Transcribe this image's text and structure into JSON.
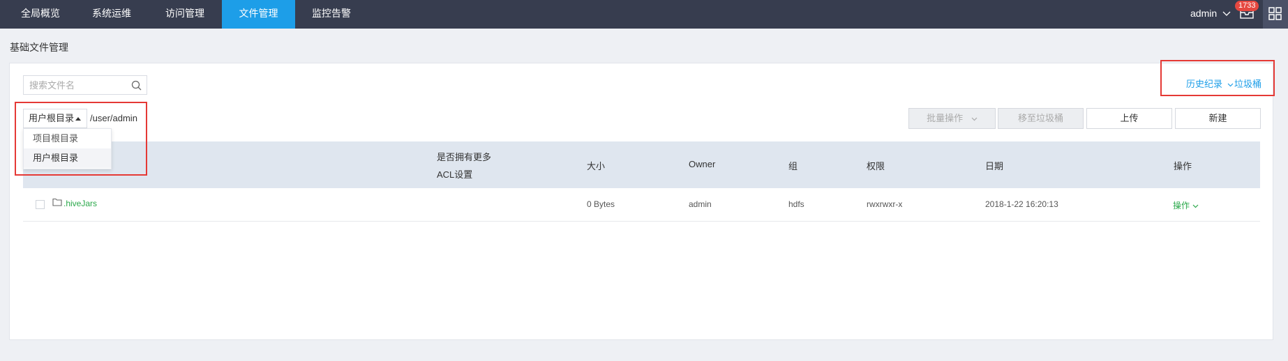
{
  "nav": {
    "items": [
      {
        "label": "全局概览"
      },
      {
        "label": "系统运维"
      },
      {
        "label": "访问管理"
      },
      {
        "label": "文件管理",
        "active": true
      },
      {
        "label": "监控告警"
      }
    ],
    "user": "admin",
    "mail_badge": "1733",
    "active_color": "#1d9ee8"
  },
  "page": {
    "title": "基础文件管理"
  },
  "search": {
    "placeholder": "搜索文件名",
    "value": ""
  },
  "top_right": {
    "history_label": "历史纪录",
    "trash_label": "垃圾桶"
  },
  "root_select": {
    "selected": "用户根目录",
    "options": [
      "项目根目录",
      "用户根目录"
    ],
    "path": "/user/admin"
  },
  "toolbar": {
    "batch_label": "批量操作",
    "move_to_trash_label": "移至垃圾桶",
    "upload_label": "上传",
    "new_label": "新建"
  },
  "table": {
    "columns": {
      "acl_line1": "是否拥有更多",
      "acl_line2": "ACL设置",
      "size": "大小",
      "owner": "Owner",
      "group": "组",
      "perm": "权限",
      "date": "日期",
      "ops": "操作"
    },
    "rows": [
      {
        "name": ".hiveJars",
        "size": "0 Bytes",
        "owner": "admin",
        "group": "hdfs",
        "perm": "rwxrwxr-x",
        "date": "2018-1-22 16:20:13",
        "op": "操作"
      }
    ]
  },
  "colors": {
    "link_blue": "#1d9ee8",
    "link_green": "#2aa84a",
    "highlight_red": "#e53935"
  }
}
